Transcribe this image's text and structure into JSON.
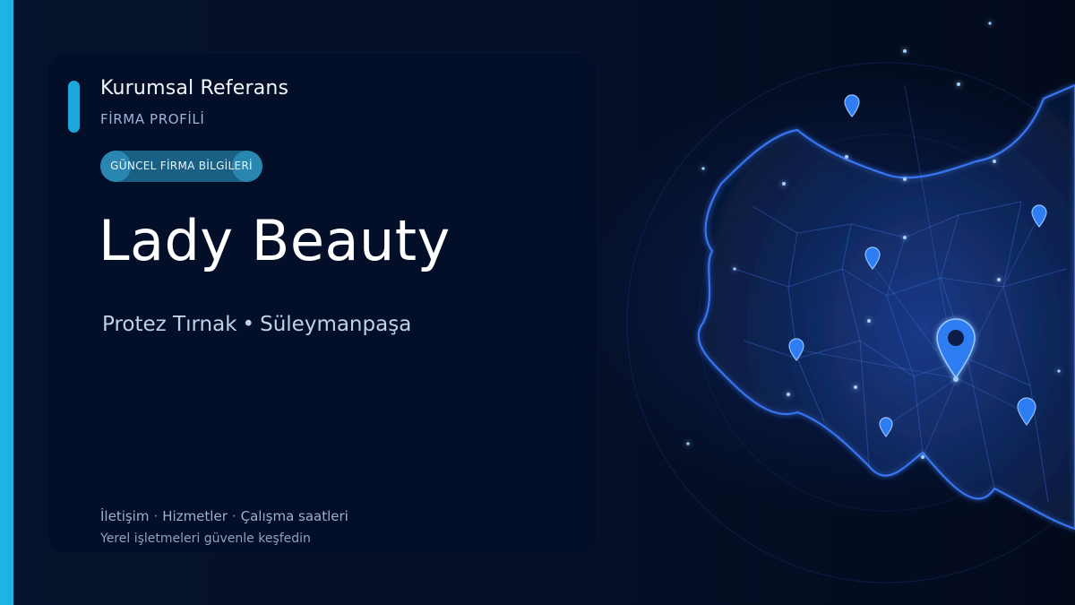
{
  "header": {
    "eyebrow": "Kurumsal Referans",
    "subtitle": "FİRMA PROFİLİ",
    "pill": "GÜNCEL FİRMA BİLGİLERİ"
  },
  "business": {
    "name": "Lady Beauty",
    "category": "Protez Tırnak",
    "separator": "•",
    "location": "Süleymanpaşa"
  },
  "footer": {
    "links": [
      "İletişim",
      "Hizmetler",
      "Çalışma saatleri"
    ],
    "link_separator": "·",
    "tagline": "Yerel işletmeleri güvenle keşfedin"
  },
  "colors": {
    "accent": "#1fb3e3",
    "background": "#030b1c",
    "card": "#031028",
    "map_glow": "#2f6dff"
  },
  "icons": [
    "map-pin-icon"
  ]
}
